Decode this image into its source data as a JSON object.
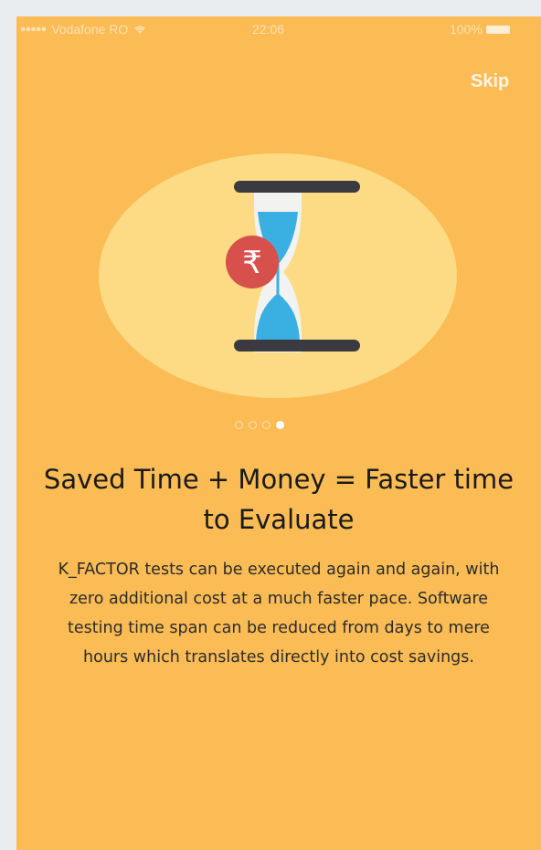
{
  "status_bar": {
    "carrier": "Vodafone RO",
    "signal": "●●●●●",
    "wifi_icon": "wifi-icon",
    "time": "22:06",
    "battery": "100%",
    "battery_icon": "battery-icon"
  },
  "skip_label": "Skip",
  "illustration": {
    "icon": "hourglass-rupee-icon",
    "currency_symbol": "₹"
  },
  "pager": {
    "total": 4,
    "active_index": 4
  },
  "title": "Saved Time + Money = Faster time to Evaluate",
  "description": "K_FACTOR tests can be executed again and again, with zero additional cost at a much faster pace. Software testing time span can be reduced from days to mere hours which translates directly into cost savings.",
  "colors": {
    "background": "#fbbc55",
    "ellipse": "#fcdb84",
    "glass_blue": "#3ab0e2",
    "coin_red": "#d8504b",
    "bar_dark": "#3a3a40"
  }
}
